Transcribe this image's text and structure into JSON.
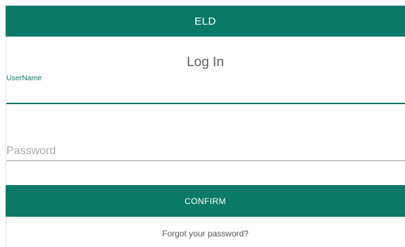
{
  "app_bar": {
    "title": "ELD"
  },
  "login": {
    "title": "Log In",
    "username_label": "UserName",
    "username_value": "",
    "password_placeholder": "Password",
    "password_value": "",
    "confirm_label": "CONFIRM",
    "forgot_link": "Forgot your password?"
  },
  "colors": {
    "brand": "#0a7a68",
    "text_muted": "#5f5f5f",
    "placeholder": "#a9a9a9"
  }
}
